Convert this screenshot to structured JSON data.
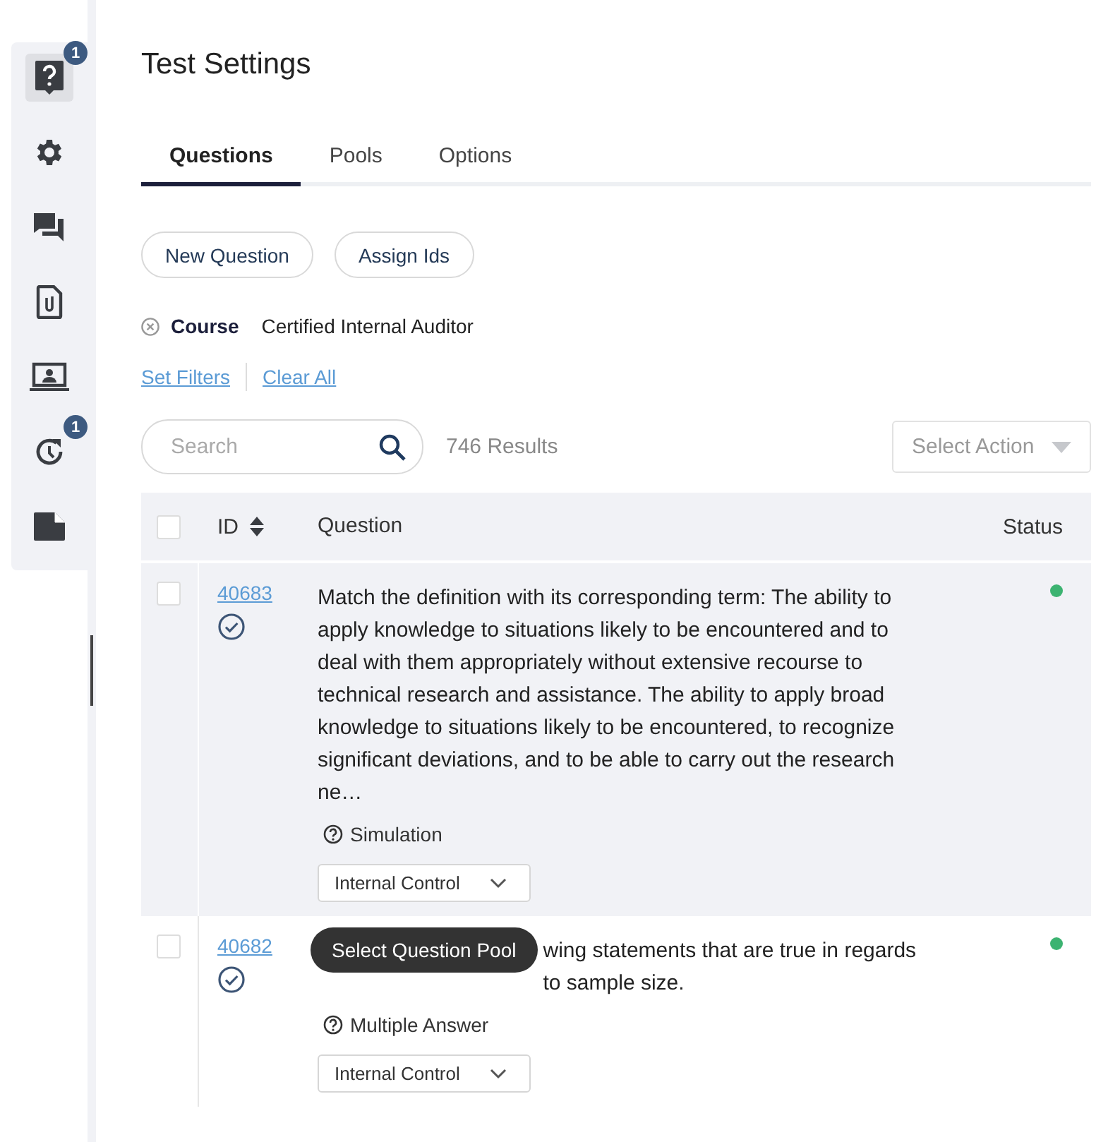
{
  "sidebar": {
    "items": [
      {
        "selected": true,
        "badge": "1"
      },
      {
        "selected": false
      },
      {
        "selected": false
      },
      {
        "selected": false
      },
      {
        "selected": false
      },
      {
        "selected": false,
        "badge": "1"
      },
      {
        "selected": false
      }
    ]
  },
  "title": "Test Settings",
  "tabs": [
    {
      "label": "Questions",
      "selected": true
    },
    {
      "label": "Pools",
      "selected": false
    },
    {
      "label": "Options",
      "selected": false
    }
  ],
  "buttons": [
    "New Question",
    "Assign Ids"
  ],
  "filter": {
    "name": "Course",
    "value": "Certified Internal Auditor"
  },
  "filter_links": [
    "Set Filters",
    "Clear All"
  ],
  "search": {
    "placeholder": "Search"
  },
  "results": "746 Results",
  "action_select": {
    "placeholder": "Select Action"
  },
  "table": {
    "select_all_checked": false,
    "columns": [
      "ID",
      "Question",
      "Status"
    ],
    "rows": [
      {
        "id": "40683",
        "highlighted": true,
        "checked": false,
        "question": "Match the definition with its corresponding term: The ability to apply knowledge to situations likely to be encountered and to deal with them appropriately without extensive recourse to technical research and assistance. The ability to apply broad knowledge to situations likely to be encountered, to recognize significant deviations, and to be able to carry out the research ne…",
        "type": "Simulation",
        "pool": "Internal Control",
        "color": "#3cb371"
      },
      {
        "id": "40682",
        "highlighted": false,
        "checked": false,
        "question": "wing statements that are true in regards to sample size.",
        "type": "Multiple Answer",
        "pool": "Internal Control",
        "color": "#3cb371"
      }
    ]
  },
  "tooltip": "Select Question Pool"
}
